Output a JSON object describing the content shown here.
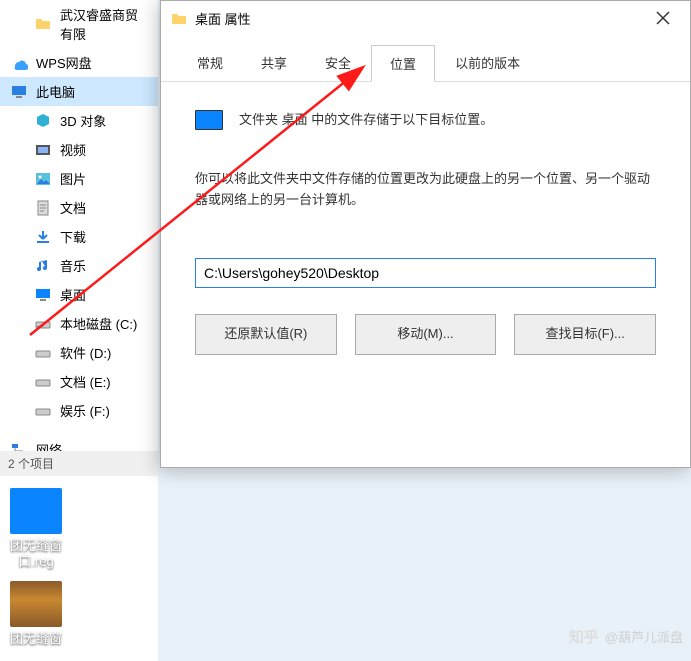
{
  "nav": {
    "items": [
      {
        "label": "武汉睿盛商贸有限",
        "icon": "folder"
      },
      {
        "label": "WPS网盘",
        "icon": "cloud"
      },
      {
        "label": "此电脑",
        "icon": "pc",
        "selected": true
      },
      {
        "label": "3D 对象",
        "icon": "3d"
      },
      {
        "label": "视频",
        "icon": "video"
      },
      {
        "label": "图片",
        "icon": "pic"
      },
      {
        "label": "文档",
        "icon": "doc"
      },
      {
        "label": "下载",
        "icon": "dl"
      },
      {
        "label": "音乐",
        "icon": "music"
      },
      {
        "label": "桌面",
        "icon": "desktop"
      },
      {
        "label": "本地磁盘 (C:)",
        "icon": "drive"
      },
      {
        "label": "软件 (D:)",
        "icon": "drive"
      },
      {
        "label": "文档 (E:)",
        "icon": "drive"
      },
      {
        "label": "娱乐 (F:)",
        "icon": "drive"
      },
      {
        "label": "网络",
        "icon": "network"
      }
    ],
    "status": "2 个项目"
  },
  "dialog": {
    "title": "桌面 属性",
    "tabs": [
      "常规",
      "共享",
      "安全",
      "位置",
      "以前的版本"
    ],
    "active_tab": 3,
    "desc1": "文件夹 桌面 中的文件存储于以下目标位置。",
    "desc2": "你可以将此文件夹中文件存储的位置更改为此硬盘上的另一个位置、另一个驱动器或网络上的另一台计算机。",
    "path": "C:\\Users\\gohey520\\Desktop",
    "buttons": {
      "restore": "还原默认值(R)",
      "move": "移动(M)...",
      "find": "查找目标(F)..."
    }
  },
  "desktop": {
    "icon1": "团无缝窗\n口.reg",
    "icon2": "团无缝窗"
  },
  "watermark": {
    "brand": "知乎",
    "author": "@葫芦儿派盘"
  }
}
